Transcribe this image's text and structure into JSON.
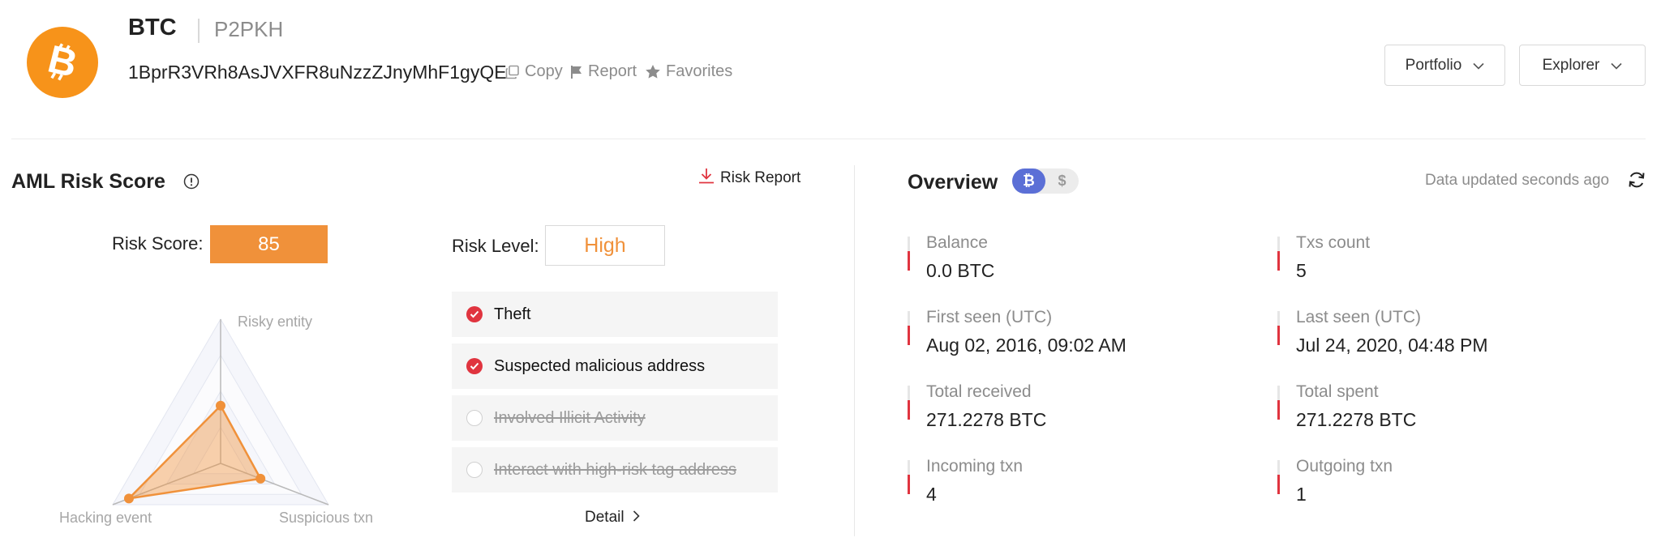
{
  "header": {
    "coin": "BTC",
    "address_type": "P2PKH",
    "address": "1BprR3VRh8AsJVXFR8uNzzZJnyMhF1gyQE",
    "actions": {
      "copy": "Copy",
      "report": "Report",
      "favorites": "Favorites"
    },
    "portfolio_label": "Portfolio",
    "explorer_label": "Explorer"
  },
  "aml": {
    "title": "AML Risk Score",
    "risk_report_label": "Risk Report",
    "score_label": "Risk Score:",
    "score": "85",
    "level_label": "Risk Level:",
    "level": "High",
    "radar": {
      "axes": [
        "Risky entity",
        "Suspicious txn",
        "Hacking event"
      ],
      "values": [
        0.4,
        0.37,
        0.85
      ],
      "max": 1
    },
    "items": [
      {
        "label": "Theft",
        "checked": true
      },
      {
        "label": "Suspected malicious address",
        "checked": true
      },
      {
        "label": "Involved Illicit Activity",
        "checked": false
      },
      {
        "label": "Interact with high-risk tag address",
        "checked": false
      }
    ],
    "detail_label": "Detail"
  },
  "overview": {
    "title": "Overview",
    "currency_toggle": {
      "btc": "₿",
      "usd": "$",
      "selected": "btc"
    },
    "updated_text": "Data updated seconds ago",
    "stats": [
      {
        "label": "Balance",
        "value": "0.0 BTC"
      },
      {
        "label": "Txs count",
        "value": "5"
      },
      {
        "label": "First seen (UTC)",
        "value": "Aug 02, 2016, 09:02 AM"
      },
      {
        "label": "Last seen (UTC)",
        "value": "Jul 24, 2020, 04:48 PM"
      },
      {
        "label": "Total received",
        "value": "271.2278 BTC"
      },
      {
        "label": "Total spent",
        "value": "271.2278 BTC"
      },
      {
        "label": "Incoming txn",
        "value": "4"
      },
      {
        "label": "Outgoing txn",
        "value": "1"
      }
    ]
  },
  "colors": {
    "bitcoin_orange": "#f7931a",
    "risk_orange": "#f0913a",
    "alert_red": "#e0343f",
    "toggle_blue": "#5b6fd6"
  },
  "icons": [
    "bitcoin-logo-icon",
    "copy-icon",
    "flag-icon",
    "star-icon",
    "chevron-down-icon",
    "info-icon",
    "download-icon",
    "check-icon",
    "chevron-right-icon",
    "refresh-icon"
  ]
}
